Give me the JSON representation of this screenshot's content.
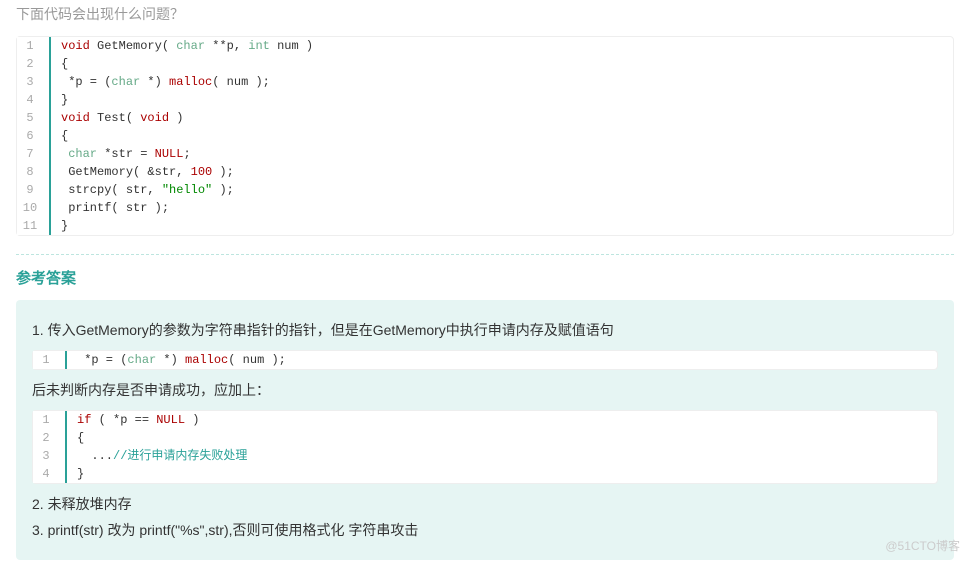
{
  "question": {
    "text": "下面代码会出现什么问题？"
  },
  "code1_lines": [
    {
      "n": "1",
      "pre": "",
      "tokens": [
        {
          "t": "void",
          "c": "tok-kw"
        },
        {
          "t": " GetMemory( ",
          "c": ""
        },
        {
          "t": "char",
          "c": "tok-type"
        },
        {
          "t": " **p, ",
          "c": ""
        },
        {
          "t": "int",
          "c": "tok-type"
        },
        {
          "t": " num )",
          "c": ""
        }
      ]
    },
    {
      "n": "2",
      "pre": "",
      "tokens": [
        {
          "t": "{",
          "c": ""
        }
      ]
    },
    {
      "n": "3",
      "pre": " ",
      "tokens": [
        {
          "t": "*p = (",
          "c": ""
        },
        {
          "t": "char",
          "c": "tok-type"
        },
        {
          "t": " *) ",
          "c": ""
        },
        {
          "t": "malloc",
          "c": "tok-fn"
        },
        {
          "t": "( num );",
          "c": ""
        }
      ]
    },
    {
      "n": "4",
      "pre": "",
      "tokens": [
        {
          "t": "}",
          "c": ""
        }
      ]
    },
    {
      "n": "5",
      "pre": "",
      "tokens": [
        {
          "t": "void",
          "c": "tok-kw"
        },
        {
          "t": " Test( ",
          "c": ""
        },
        {
          "t": "void",
          "c": "tok-kw"
        },
        {
          "t": " )",
          "c": ""
        }
      ]
    },
    {
      "n": "6",
      "pre": "",
      "tokens": [
        {
          "t": "{",
          "c": ""
        }
      ]
    },
    {
      "n": "7",
      "pre": " ",
      "tokens": [
        {
          "t": "char",
          "c": "tok-type"
        },
        {
          "t": " *str = ",
          "c": ""
        },
        {
          "t": "NULL",
          "c": "tok-kw"
        },
        {
          "t": ";",
          "c": ""
        }
      ]
    },
    {
      "n": "8",
      "pre": " ",
      "tokens": [
        {
          "t": "GetMemory( &str, ",
          "c": ""
        },
        {
          "t": "100",
          "c": "tok-num"
        },
        {
          "t": " );",
          "c": ""
        }
      ]
    },
    {
      "n": "9",
      "pre": " ",
      "tokens": [
        {
          "t": "strcpy( str, ",
          "c": ""
        },
        {
          "t": "\"hello\"",
          "c": "tok-str"
        },
        {
          "t": " );",
          "c": ""
        }
      ]
    },
    {
      "n": "10",
      "pre": " ",
      "tokens": [
        {
          "t": "printf( str );",
          "c": ""
        }
      ]
    },
    {
      "n": "11",
      "pre": "",
      "tokens": [
        {
          "t": "}",
          "c": ""
        }
      ]
    }
  ],
  "answer": {
    "title": "参考答案",
    "para1": "1. 传入GetMemory的参数为字符串指针的指针，但是在GetMemory中执行申请内存及赋值语句",
    "para2": "后未判断内存是否申请成功，应加上：",
    "para3": "2. 未释放堆内存",
    "para4": "3. printf(str) 改为 printf(\"%s\",str),否则可使用格式化 字符串攻击"
  },
  "code2_lines": [
    {
      "n": "1",
      "pre": " ",
      "tokens": [
        {
          "t": "*p = (",
          "c": ""
        },
        {
          "t": "char",
          "c": "tok-type"
        },
        {
          "t": " *) ",
          "c": ""
        },
        {
          "t": "malloc",
          "c": "tok-fn"
        },
        {
          "t": "( num );",
          "c": ""
        }
      ]
    }
  ],
  "code3_lines": [
    {
      "n": "1",
      "pre": "",
      "tokens": [
        {
          "t": "if",
          "c": "tok-kw"
        },
        {
          "t": " ( *p == ",
          "c": ""
        },
        {
          "t": "NULL",
          "c": "tok-kw"
        },
        {
          "t": " )",
          "c": ""
        }
      ]
    },
    {
      "n": "2",
      "pre": "",
      "tokens": [
        {
          "t": "{",
          "c": ""
        }
      ]
    },
    {
      "n": "3",
      "pre": "  ",
      "tokens": [
        {
          "t": "...",
          "c": ""
        },
        {
          "t": "//进行申请内存失败处理",
          "c": "tok-cmt"
        }
      ]
    },
    {
      "n": "4",
      "pre": "",
      "tokens": [
        {
          "t": "}",
          "c": ""
        }
      ]
    }
  ],
  "watermark": {
    "text": "@51CTO博客"
  }
}
